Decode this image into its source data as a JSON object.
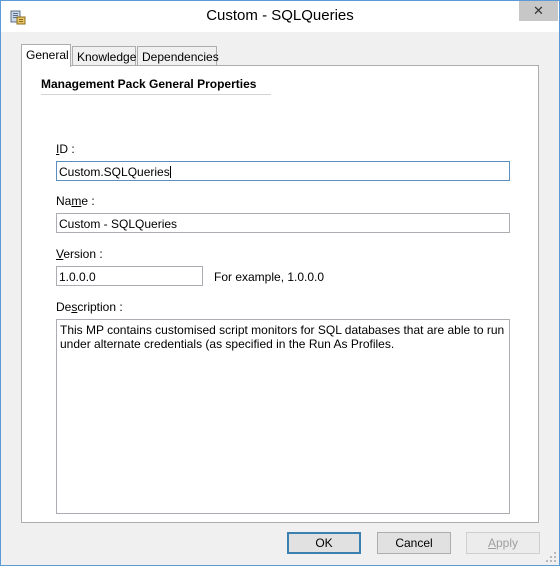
{
  "window": {
    "title": "Custom - SQLQueries",
    "close_glyph": "✕",
    "app_icon": "properties-sheet-icon"
  },
  "tabs": [
    {
      "label": "General",
      "active": true
    },
    {
      "label": "Knowledge",
      "active": false
    },
    {
      "label": "Dependencies",
      "active": false
    }
  ],
  "general": {
    "section_title": "Management Pack General Properties",
    "id": {
      "label_access": "I",
      "label_rest": "D :",
      "value": "Custom.SQLQueries"
    },
    "name": {
      "label_pre": "Na",
      "label_access": "m",
      "label_rest": "e :",
      "value": "Custom - SQLQueries"
    },
    "version": {
      "label_access": "V",
      "label_rest": "ersion :",
      "value": "1.0.0.0",
      "hint": "For example, 1.0.0.0"
    },
    "description": {
      "label_pre": "De",
      "label_access": "s",
      "label_rest": "cription :",
      "value": "This MP contains customised script monitors for SQL databases that are able to run under alternate credentials (as specified in the Run As Profiles."
    }
  },
  "buttons": {
    "ok": "OK",
    "cancel": "Cancel",
    "apply_access": "A",
    "apply_rest": "pply"
  },
  "colors": {
    "window_border": "#5b9bd5",
    "focus_border": "#5a8fc0",
    "default_button_border": "#3c7fb1"
  }
}
